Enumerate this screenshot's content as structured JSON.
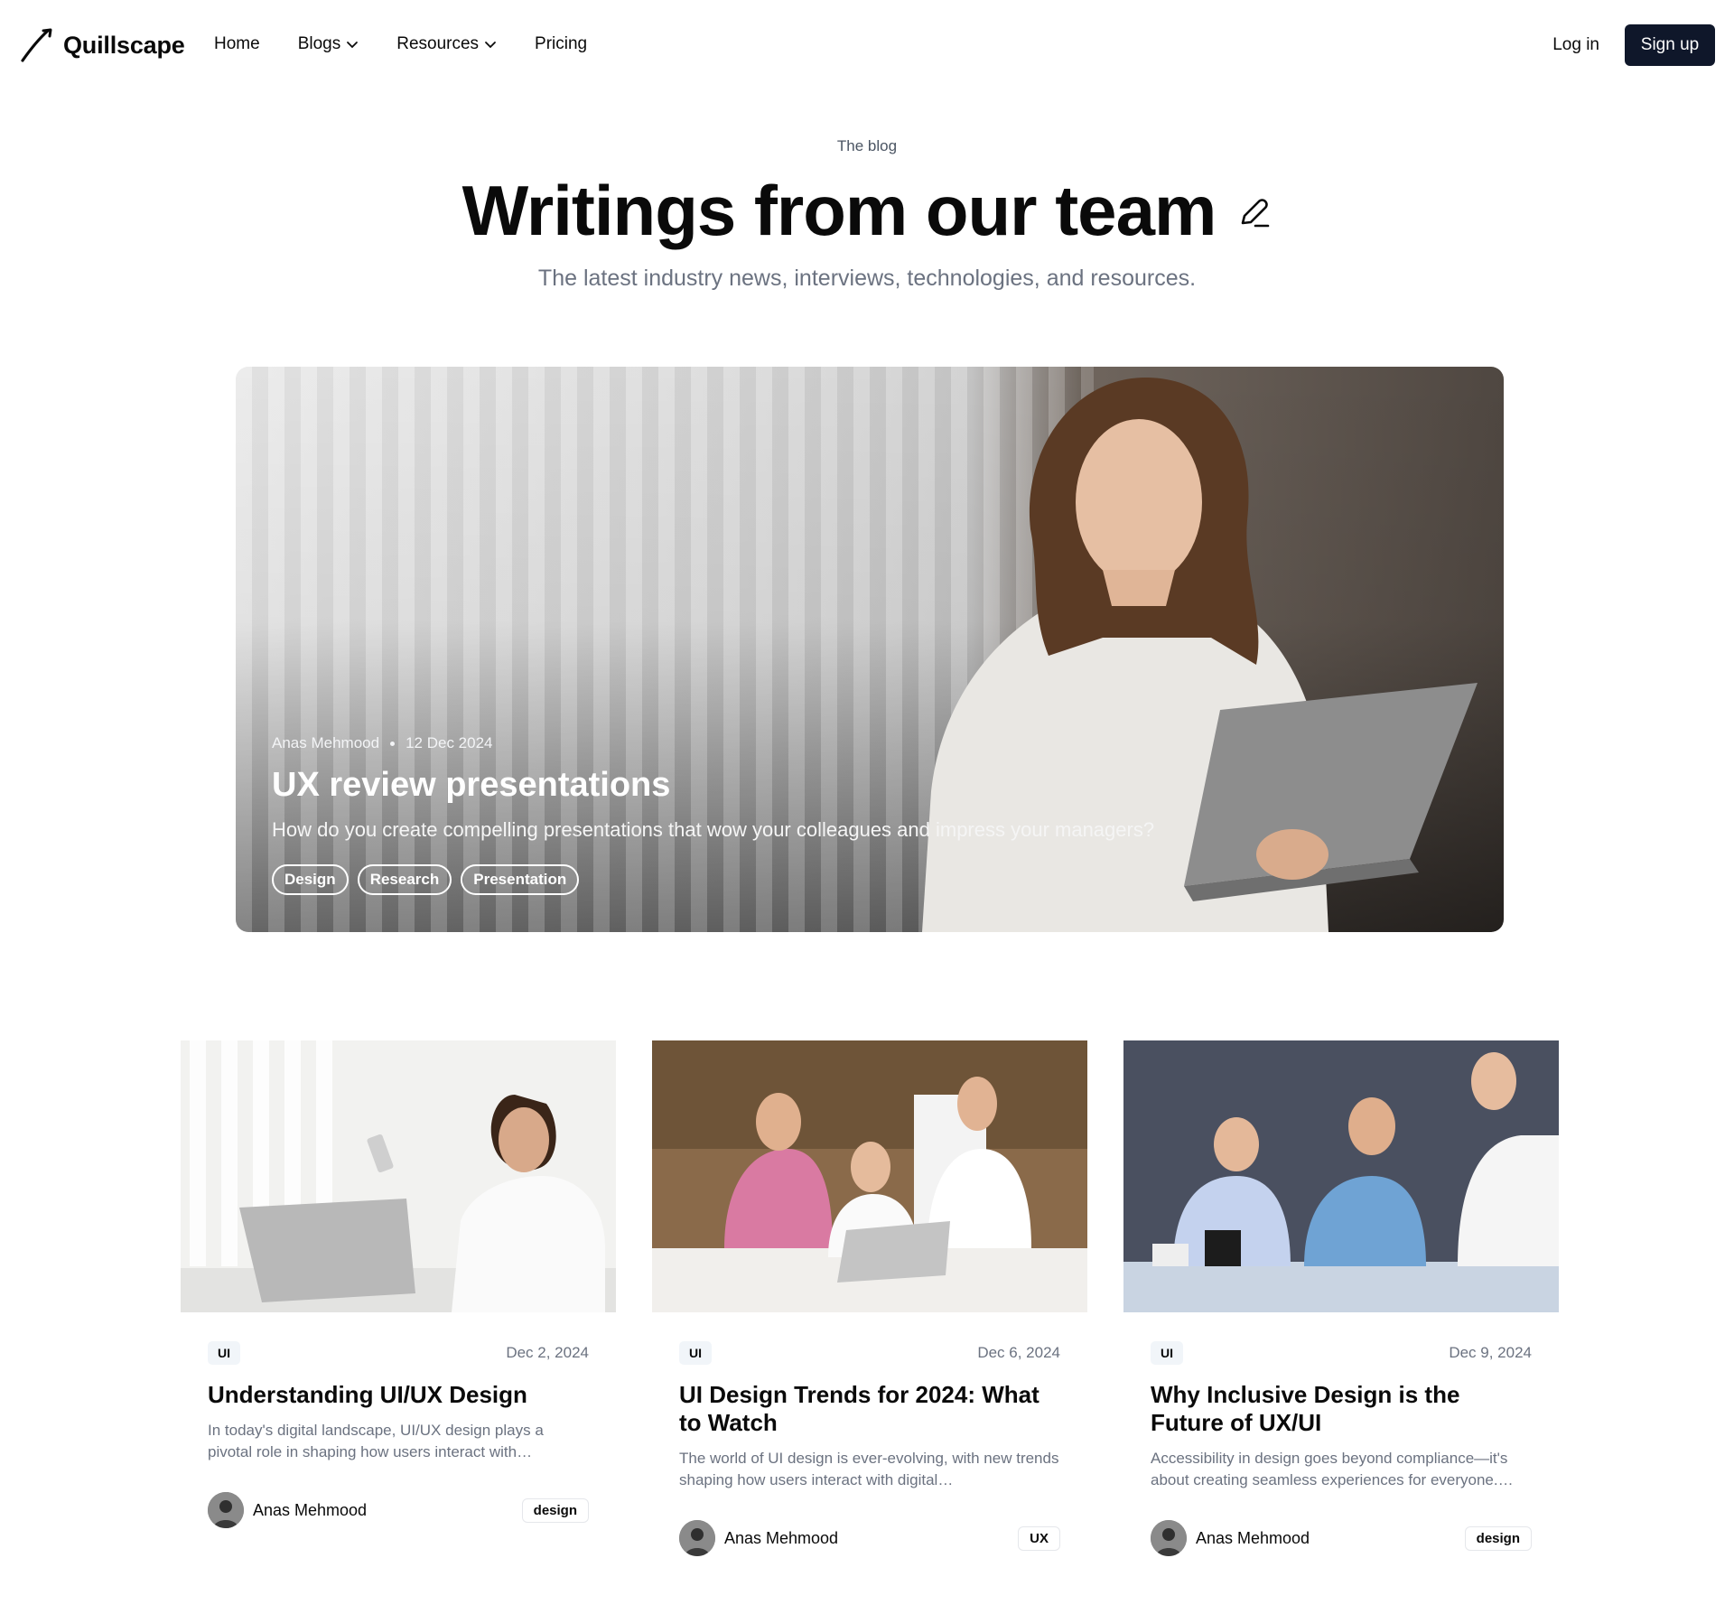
{
  "nav": {
    "brand": "Quillscape",
    "links": [
      {
        "label": "Home"
      },
      {
        "label": "Blogs"
      },
      {
        "label": "Resources"
      },
      {
        "label": "Pricing"
      }
    ],
    "login": "Log in",
    "signup": "Sign up"
  },
  "hero": {
    "eyebrow": "The blog",
    "title": "Writings from our team",
    "subtitle": "The latest industry news, interviews, technologies, and resources."
  },
  "featured": {
    "author": "Anas Mehmood",
    "date": "12 Dec 2024",
    "title": "UX review presentations",
    "description": "How do you create compelling presentations that wow your colleagues and impress your managers?",
    "tags": [
      "Design",
      "Research",
      "Presentation"
    ]
  },
  "posts": [
    {
      "category": "UI",
      "date": "Dec 2, 2024",
      "title": "Understanding UI/UX Design",
      "excerpt": "In today's digital landscape, UI/UX design plays a pivotal role in shaping how users interact with…",
      "author": "Anas Mehmood",
      "tag": "design"
    },
    {
      "category": "UI",
      "date": "Dec 6, 2024",
      "title": "UI Design Trends for 2024: What to Watch",
      "excerpt": "The world of UI design is ever-evolving, with new trends shaping how users interact with digital…",
      "author": "Anas Mehmood",
      "tag": "UX"
    },
    {
      "category": "UI",
      "date": "Dec 9, 2024",
      "title": "Why Inclusive Design is the Future of UX/UI",
      "excerpt": "Accessibility in design goes beyond compliance—it's about creating seamless experiences for everyone.…",
      "author": "Anas Mehmood",
      "tag": "design"
    }
  ]
}
